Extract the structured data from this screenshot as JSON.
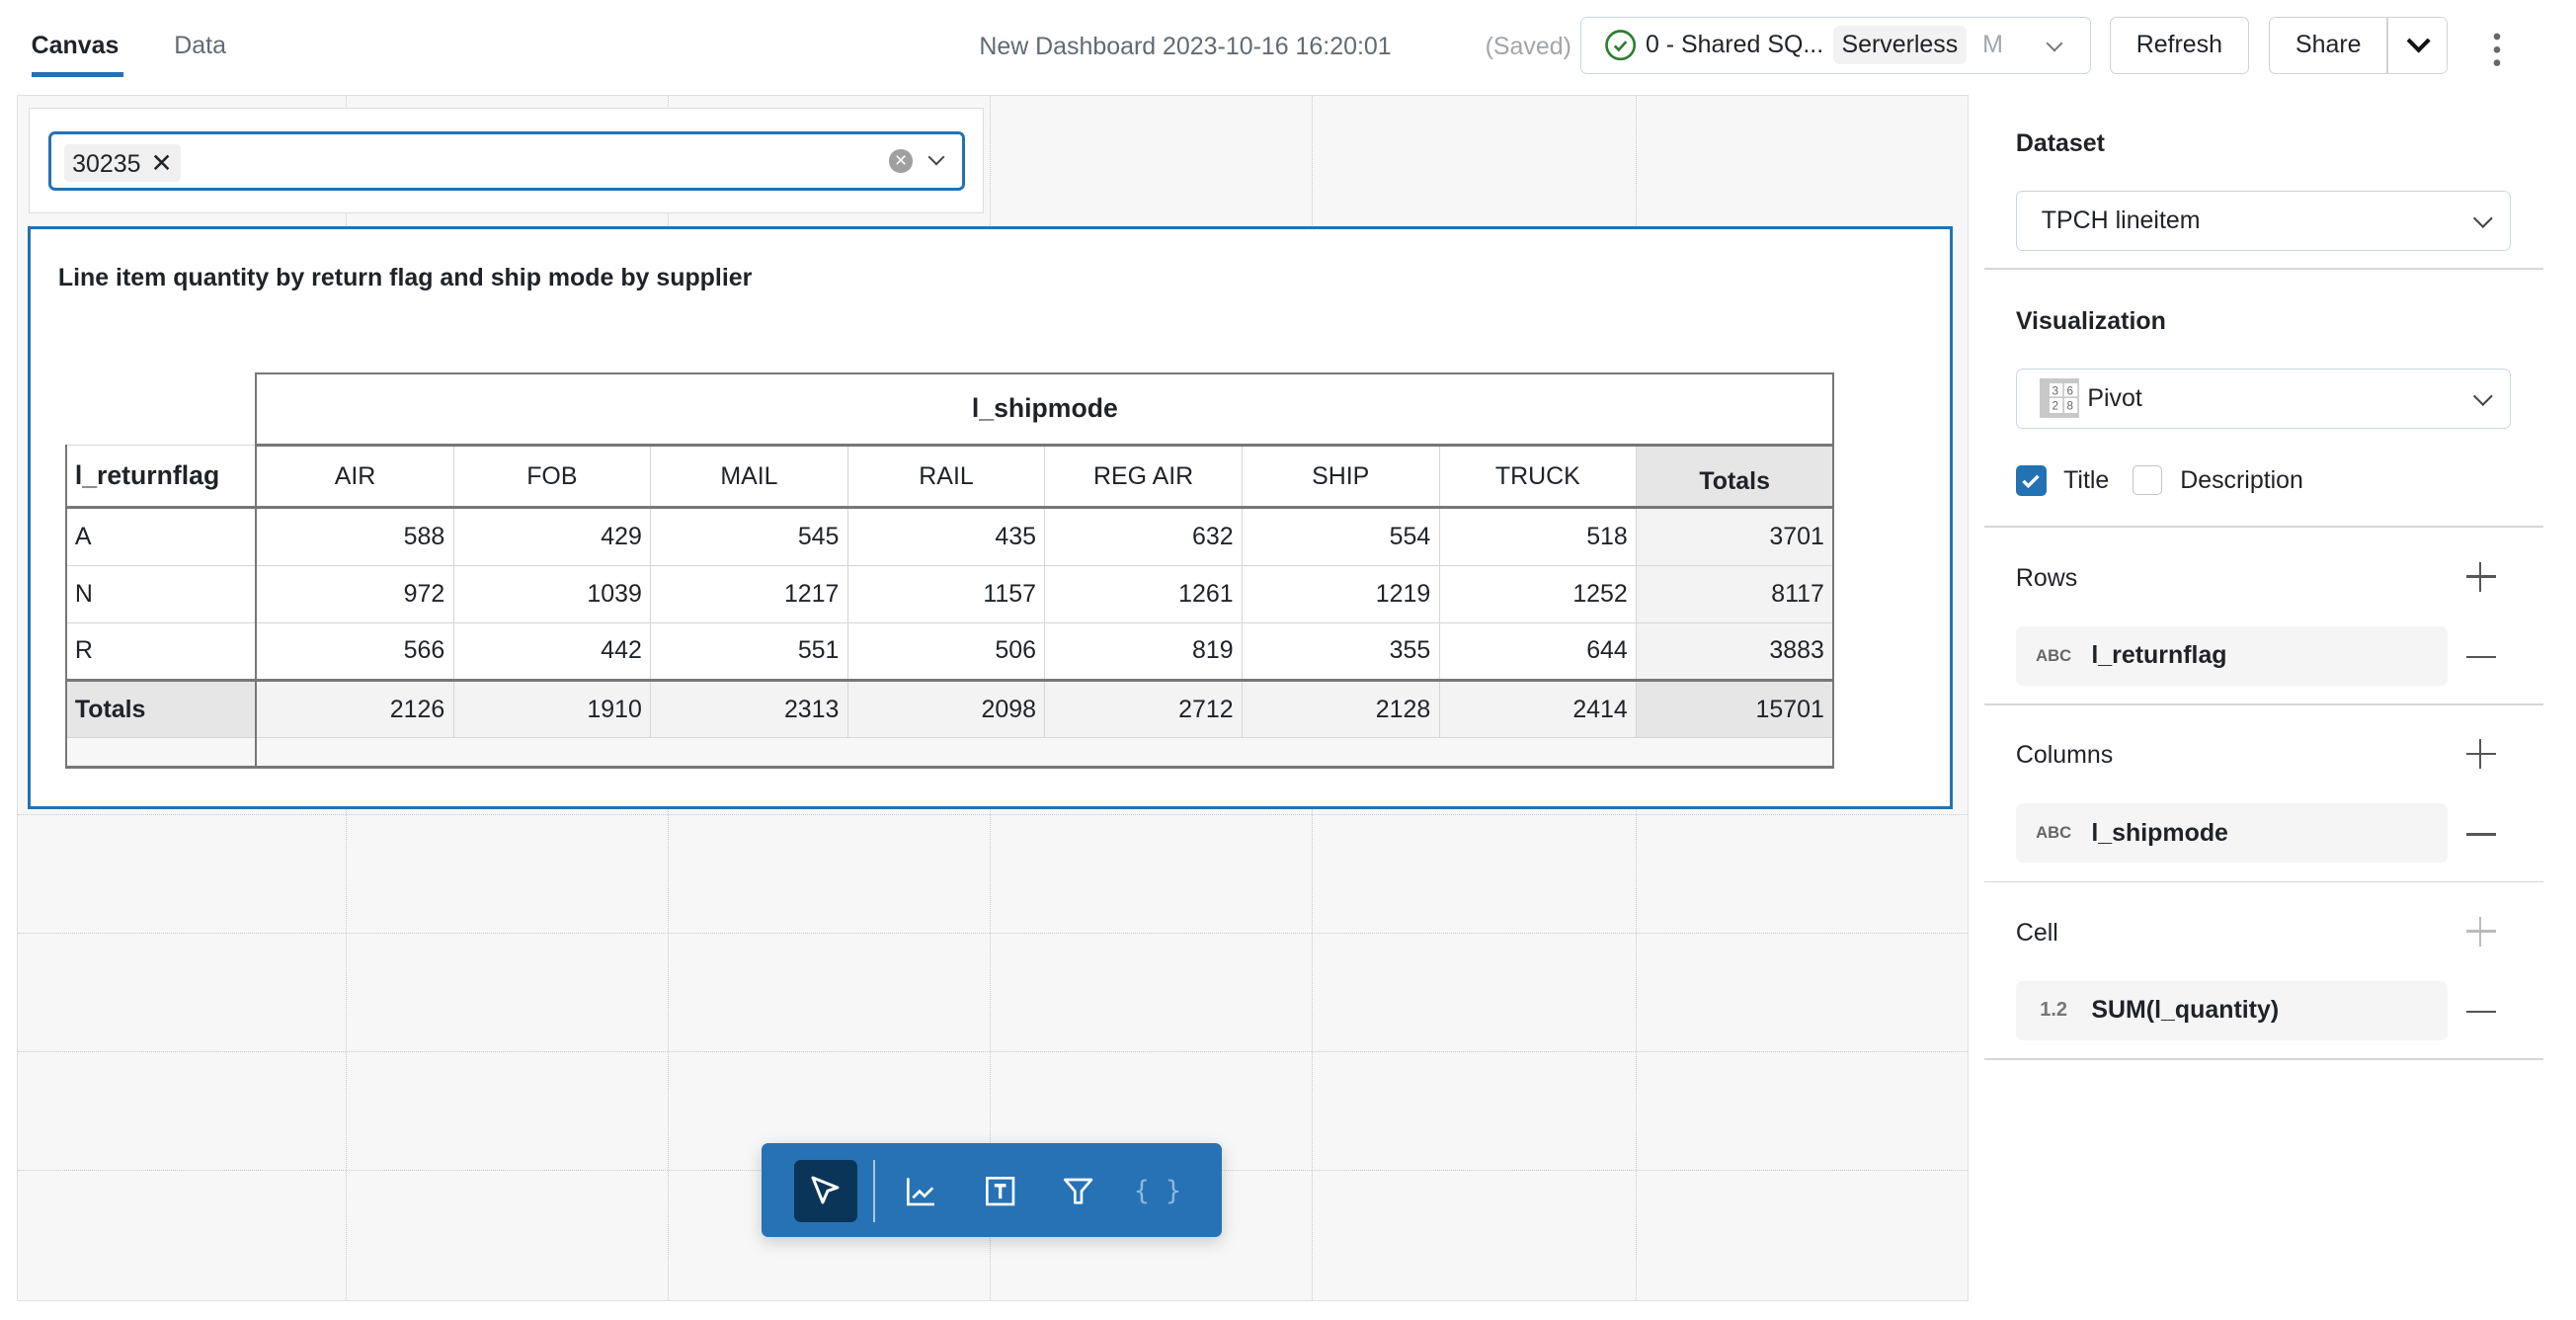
{
  "header": {
    "tabs": [
      {
        "label": "Canvas",
        "active": true
      },
      {
        "label": "Data",
        "active": false
      }
    ],
    "dashboard_title": "New Dashboard 2023-10-16 16:20:01",
    "save_status": "(Saved)",
    "warehouse": {
      "name": "0 - Shared SQ...",
      "badge": "Serverless",
      "size": "M",
      "status_icon": "check-circle-icon"
    },
    "refresh_label": "Refresh",
    "share_label": "Share"
  },
  "filter": {
    "chip": "30235"
  },
  "widget": {
    "title": "Line item quantity by return flag and ship mode by supplier",
    "pivot": {
      "column_field": "l_shipmode",
      "row_field": "l_returnflag",
      "columns": [
        "AIR",
        "FOB",
        "MAIL",
        "RAIL",
        "REG AIR",
        "SHIP",
        "TRUCK"
      ],
      "totals_label": "Totals",
      "rows": [
        {
          "label": "A",
          "values": [
            "588",
            "429",
            "545",
            "435",
            "632",
            "554",
            "518"
          ],
          "total": "3701"
        },
        {
          "label": "N",
          "values": [
            "972",
            "1039",
            "1217",
            "1157",
            "1261",
            "1219",
            "1252"
          ],
          "total": "8117"
        },
        {
          "label": "R",
          "values": [
            "566",
            "442",
            "551",
            "506",
            "819",
            "355",
            "644"
          ],
          "total": "3883"
        }
      ],
      "totals": {
        "values": [
          "2126",
          "1910",
          "2313",
          "2098",
          "2712",
          "2128",
          "2414"
        ],
        "total": "15701"
      }
    }
  },
  "panel": {
    "dataset_label": "Dataset",
    "dataset_value": "TPCH lineitem",
    "viz_label": "Visualization",
    "viz_value": "Pivot",
    "title_checkbox": {
      "label": "Title",
      "checked": true
    },
    "description_checkbox": {
      "label": "Description",
      "checked": false
    },
    "rows_label": "Rows",
    "rows_field": "l_returnflag",
    "rows_type": "ABC",
    "columns_label": "Columns",
    "columns_field": "l_shipmode",
    "columns_type": "ABC",
    "cell_label": "Cell",
    "cell_field": "SUM(l_quantity)",
    "cell_type": "1.2"
  },
  "toolbar": {
    "tools": [
      "select-icon",
      "chart-icon",
      "text-icon",
      "filter-icon",
      "parameter-icon"
    ],
    "active": "select-icon"
  },
  "colors": {
    "accent": "#2272b4",
    "toolbar": "#2672b5",
    "toolbar_active": "#0b3558",
    "success": "#2e7d32"
  }
}
